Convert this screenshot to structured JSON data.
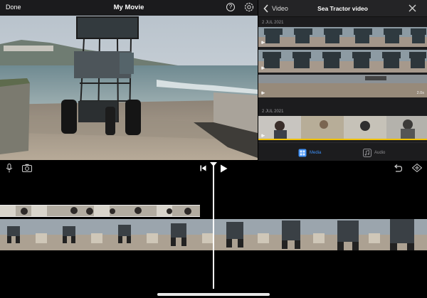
{
  "header": {
    "done_label": "Done",
    "project_title": "My Movie"
  },
  "media_panel": {
    "back_label": "Video",
    "title": "Sea Tractor video",
    "sections": [
      {
        "date": "2 JUL 2021",
        "clips": [
          {
            "duration": ""
          },
          {
            "duration": ""
          },
          {
            "duration": "2.0s"
          }
        ]
      },
      {
        "date": "2 JUL 2021",
        "clips": [
          {
            "duration": ""
          }
        ]
      }
    ],
    "tabs": [
      {
        "label": "Media",
        "selected": true
      },
      {
        "label": "Audio",
        "selected": false
      }
    ]
  },
  "colors": {
    "accent": "#3d8ff6",
    "bar_bg": "#1b1b1d",
    "panel_bg": "#1c1c1e",
    "clip_border": "#f2c200"
  },
  "icons": {
    "help": "help-circle-icon",
    "settings": "gear-icon",
    "back": "chevron-left-icon",
    "close": "close-icon",
    "media_tab": "media-tab-icon",
    "audio_tab": "audio-tab-icon",
    "voiceover": "microphone-icon",
    "camera": "camera-icon",
    "skip_back": "skip-to-start-icon",
    "play": "play-icon",
    "undo": "undo-icon",
    "audio_wave": "audio-waveform-icon"
  }
}
